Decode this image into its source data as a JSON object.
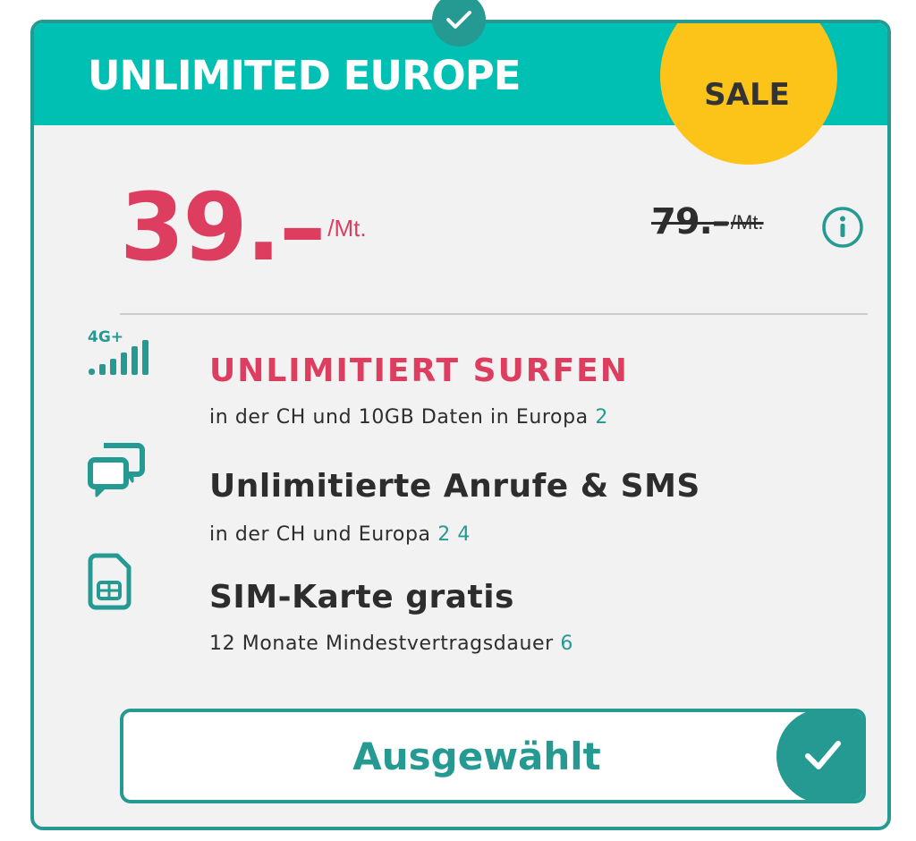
{
  "plan": {
    "title": "UNLIMITED EUROPE",
    "sale_badge": "SALE",
    "price": "39.–",
    "price_unit": "/Mt.",
    "old_price": "79.–",
    "old_price_unit": "/Mt."
  },
  "features": [
    {
      "icon": "network-4g-icon",
      "icon_label": "4G+",
      "title": "UNLIMITIERT SURFEN",
      "subtitle": "in der CH und 10GB Daten in Europa",
      "footnotes": "2"
    },
    {
      "icon": "chat-icon",
      "title": "Unlimitierte Anrufe & SMS",
      "subtitle": "in der CH und Europa",
      "footnotes": "2 4"
    },
    {
      "icon": "sim-card-icon",
      "title": "SIM-Karte gratis",
      "subtitle": "12 Monate Mindestvertragsdauer",
      "footnotes": "6"
    }
  ],
  "select_button": {
    "label": "Ausgewählt",
    "selected": true
  },
  "colors": {
    "teal": "#00bfb3",
    "teal_dark": "#249a92",
    "price_red": "#dd3e60",
    "sale_yellow": "#fcc419",
    "text": "#2d2d2d",
    "card_background": "#f2f2f2"
  }
}
